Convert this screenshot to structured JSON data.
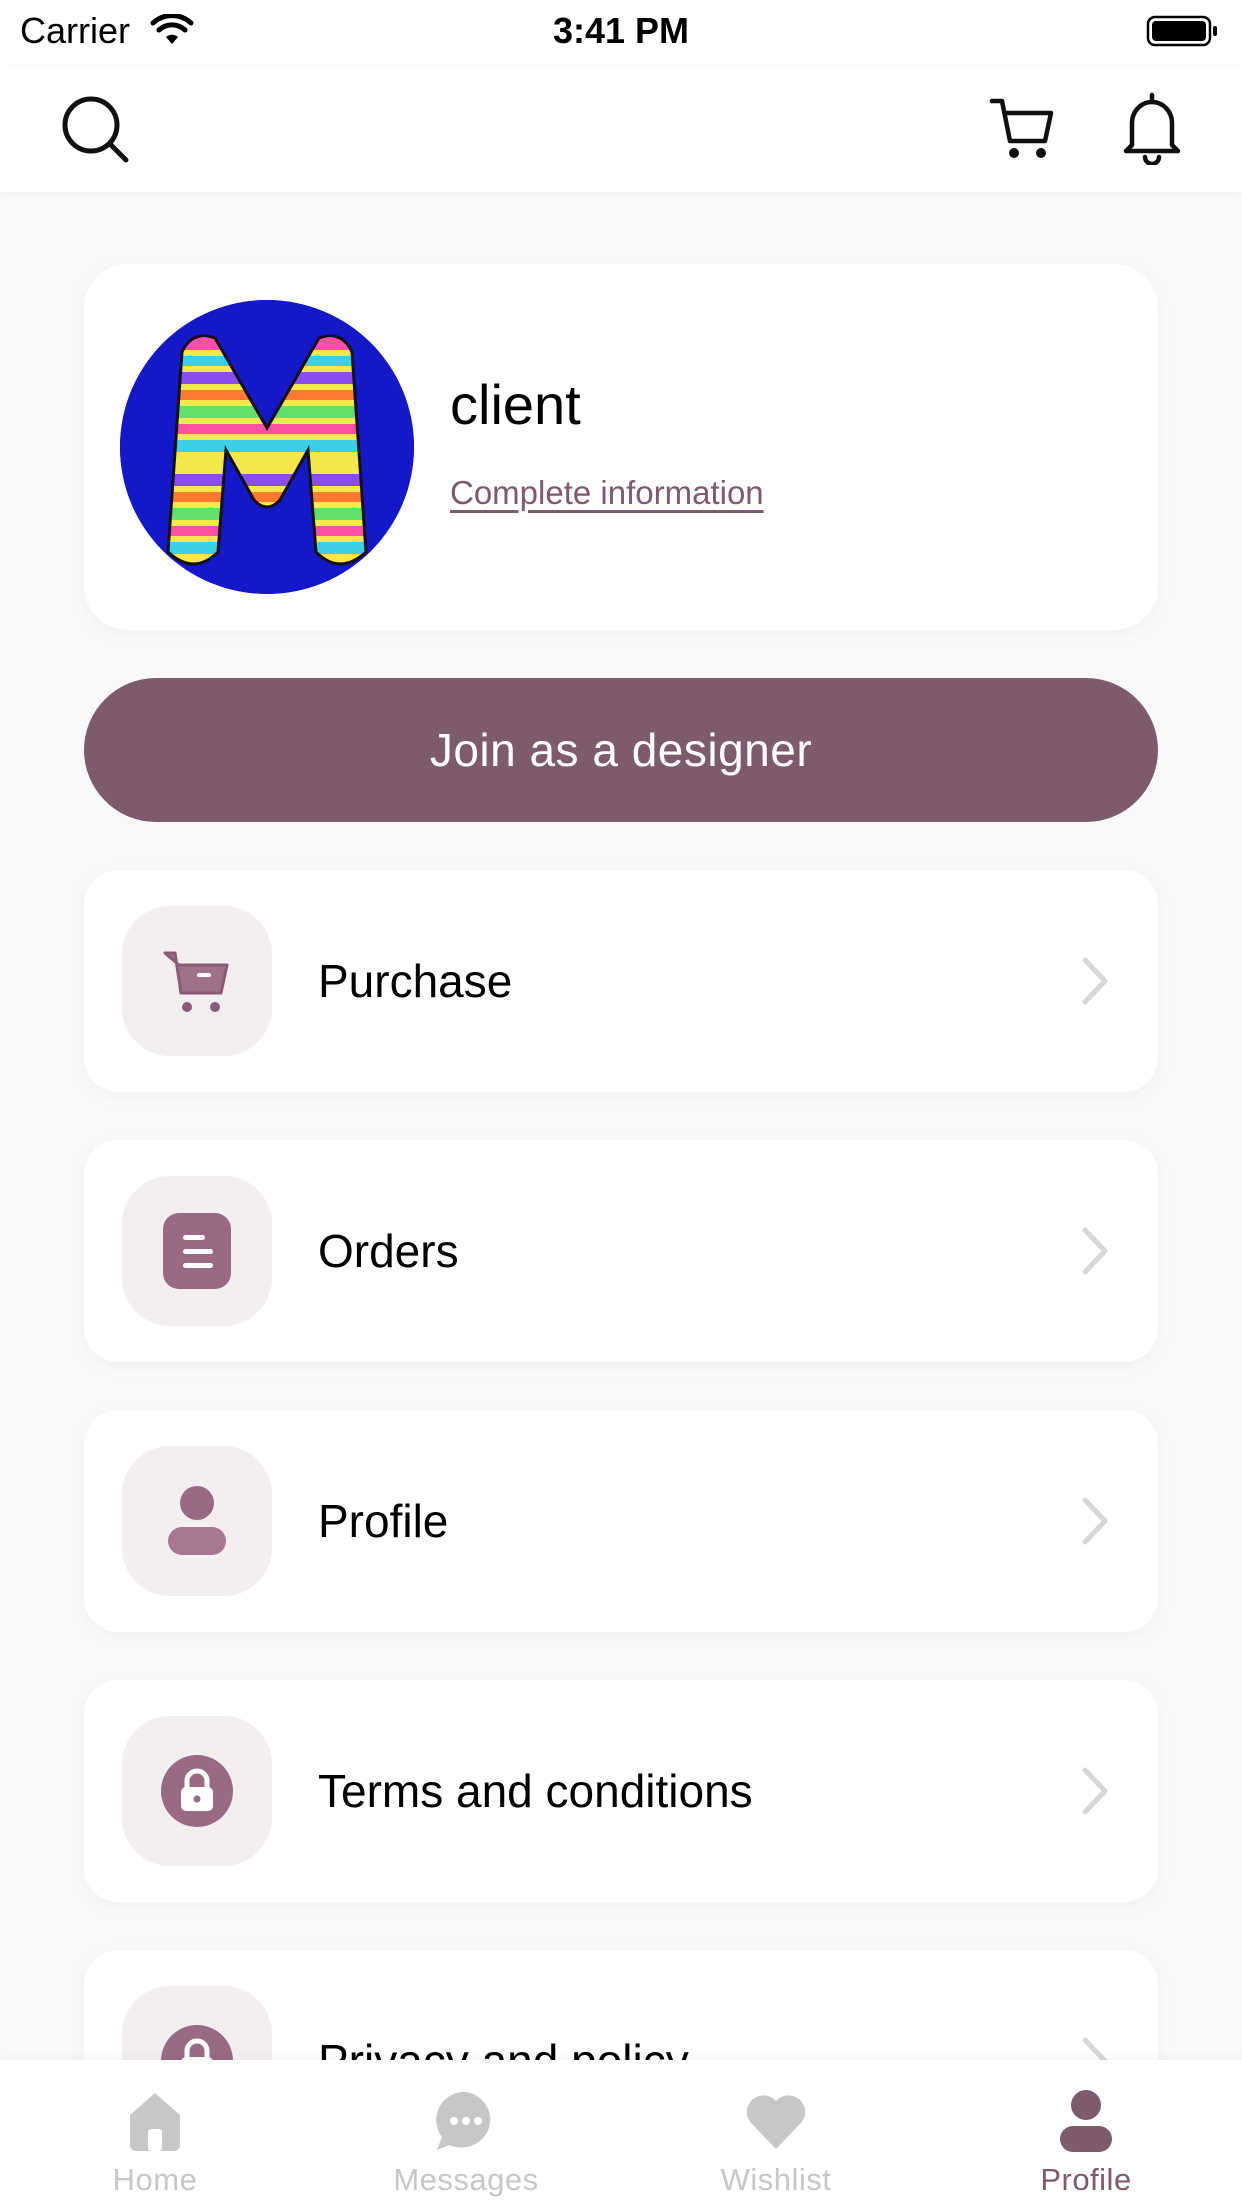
{
  "status_bar": {
    "carrier": "Carrier",
    "time": "3:41 PM"
  },
  "top_nav": {
    "search_icon": "search-icon",
    "cart_icon": "cart-icon",
    "bell_icon": "bell-icon"
  },
  "profile": {
    "name": "client",
    "complete_info_link": "Complete information",
    "avatar_icon": "avatar-letter-m"
  },
  "join_button": {
    "label": "Join as a designer"
  },
  "menu": {
    "items": [
      {
        "label": "Purchase",
        "icon": "cart-icon"
      },
      {
        "label": "Orders",
        "icon": "document-icon"
      },
      {
        "label": "Profile",
        "icon": "user-icon"
      },
      {
        "label": "Terms and conditions",
        "icon": "lock-icon"
      },
      {
        "label": "Privacy and policy",
        "icon": "lock-icon"
      }
    ]
  },
  "tab_bar": {
    "tabs": [
      {
        "label": "Home",
        "icon": "home-icon",
        "active": false
      },
      {
        "label": "Messages",
        "icon": "chat-icon",
        "active": false
      },
      {
        "label": "Wishlist",
        "icon": "heart-icon",
        "active": false
      },
      {
        "label": "Profile",
        "icon": "user-icon",
        "active": true
      }
    ]
  },
  "colors": {
    "accent": "#7d5b6d",
    "icon_tile": "#f3eef0",
    "inactive_tab": "#c7c7c7",
    "background": "#f9f9fa"
  }
}
